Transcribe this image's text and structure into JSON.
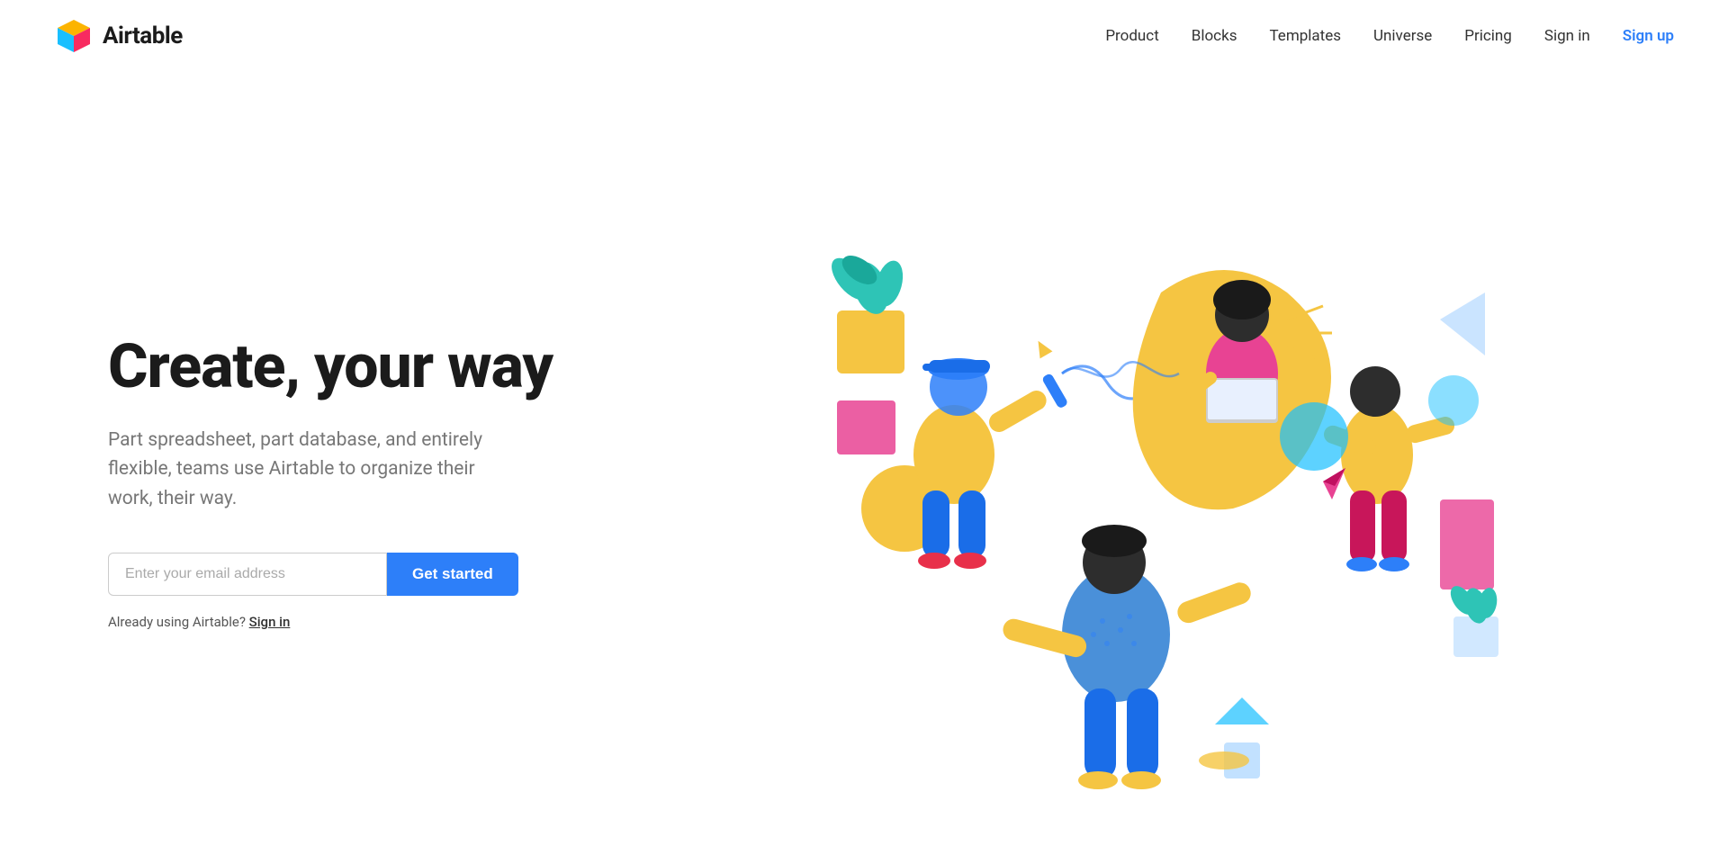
{
  "nav": {
    "logo_text": "Airtable",
    "links": [
      {
        "label": "Product",
        "href": "#"
      },
      {
        "label": "Blocks",
        "href": "#"
      },
      {
        "label": "Templates",
        "href": "#"
      },
      {
        "label": "Universe",
        "href": "#"
      },
      {
        "label": "Pricing",
        "href": "#"
      },
      {
        "label": "Sign in",
        "href": "#"
      },
      {
        "label": "Sign up",
        "href": "#",
        "highlight": true
      }
    ]
  },
  "hero": {
    "title": "Create, your way",
    "subtitle": "Part spreadsheet, part database, and entirely flexible, teams use Airtable to organize their work, their way.",
    "email_placeholder": "Enter your email address",
    "cta_button": "Get started",
    "signin_prefix": "Already using Airtable?",
    "signin_link": "Sign in"
  },
  "colors": {
    "brand_blue": "#2d7ff9",
    "yellow": "#f5c542",
    "pink": "#e84393",
    "teal": "#2ec4b6",
    "red": "#e8304a"
  }
}
